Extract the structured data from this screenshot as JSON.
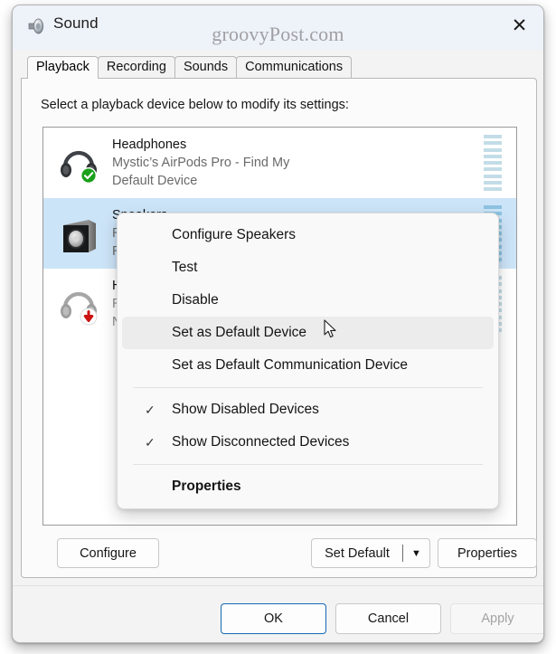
{
  "window": {
    "title": "Sound",
    "title_icon": "speaker-icon",
    "close_label": "✕",
    "watermark": "groovyPost.com"
  },
  "tabs": [
    {
      "label": "Playback",
      "active": true
    },
    {
      "label": "Recording",
      "active": false
    },
    {
      "label": "Sounds",
      "active": false
    },
    {
      "label": "Communications",
      "active": false
    }
  ],
  "main": {
    "instruction": "Select a playback device below to modify its settings:"
  },
  "devices": [
    {
      "icon": "headphones-icon",
      "badge": "check-badge",
      "name": "Headphones",
      "subtitle": "Mystic’s AirPods Pro - Find My",
      "status": "Default Device",
      "selected": false,
      "meter_active": false
    },
    {
      "icon": "speaker-box-icon",
      "badge": "none",
      "name": "Speakers",
      "subtitle": "Realtek(R) Audio",
      "status": "Ready",
      "selected": true,
      "meter_active": true
    },
    {
      "icon": "headphones-disconnected-icon",
      "badge": "down-arrow-badge",
      "name": "Headphones",
      "subtitle": "Realtek(R) Audio",
      "status": "Not plugged in",
      "selected": false,
      "meter_active": false
    }
  ],
  "list_buttons": {
    "configure": "Configure",
    "set_default": "Set Default",
    "set_default_arrow": "▼",
    "properties": "Properties"
  },
  "footer": {
    "ok": "OK",
    "cancel": "Cancel",
    "apply": "Apply"
  },
  "context_menu": [
    {
      "label": "Configure Speakers",
      "checked": false,
      "hovered": false,
      "bold": false,
      "sep_after": false
    },
    {
      "label": "Test",
      "checked": false,
      "hovered": false,
      "bold": false,
      "sep_after": false
    },
    {
      "label": "Disable",
      "checked": false,
      "hovered": false,
      "bold": false,
      "sep_after": false
    },
    {
      "label": "Set as Default Device",
      "checked": false,
      "hovered": true,
      "bold": false,
      "sep_after": false
    },
    {
      "label": "Set as Default Communication Device",
      "checked": false,
      "hovered": false,
      "bold": false,
      "sep_after": true
    },
    {
      "label": "Show Disabled Devices",
      "checked": true,
      "hovered": false,
      "bold": false,
      "sep_after": false
    },
    {
      "label": "Show Disconnected Devices",
      "checked": true,
      "hovered": false,
      "bold": false,
      "sep_after": true
    },
    {
      "label": "Properties",
      "checked": false,
      "hovered": false,
      "bold": true,
      "sep_after": false
    }
  ],
  "check_glyph": "✓",
  "colors": {
    "selection": "#cce4f7",
    "accent": "#1569b5",
    "meter_idle": "#c3dde8",
    "meter_active": "#8dc3e0",
    "default_badge": "#1aa01a",
    "disconnected_badge": "#cc1111",
    "titlebar": "#eef2f9"
  }
}
